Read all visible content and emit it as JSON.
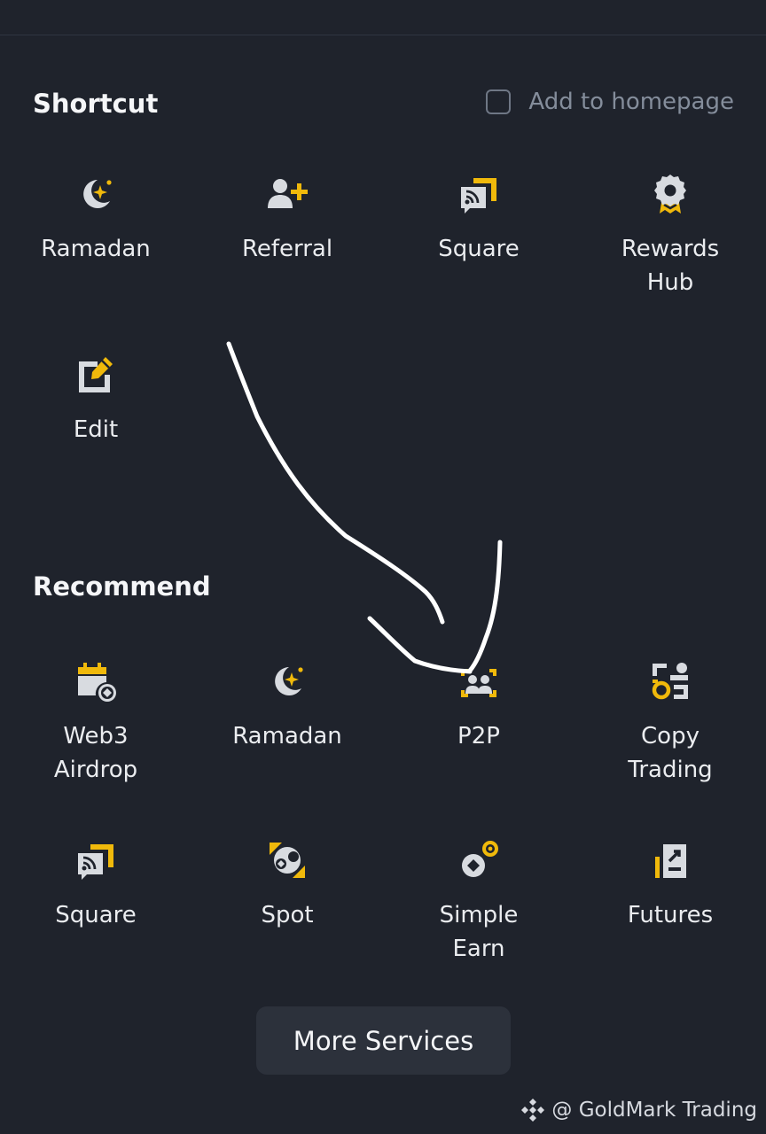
{
  "shortcut": {
    "title": "Shortcut",
    "add_to_homepage": "Add to homepage",
    "items": [
      {
        "label": "Ramadan",
        "icon": "moon-star-icon"
      },
      {
        "label": "Referral",
        "icon": "add-person-icon"
      },
      {
        "label": "Square",
        "icon": "square-feed-icon"
      },
      {
        "label": "Rewards\nHub",
        "icon": "rewards-medal-icon"
      },
      {
        "label": "Edit",
        "icon": "edit-icon"
      }
    ]
  },
  "recommend": {
    "title": "Recommend",
    "items": [
      {
        "label": "Web3\nAirdrop",
        "icon": "calendar-airdrop-icon"
      },
      {
        "label": "Ramadan",
        "icon": "moon-star-icon"
      },
      {
        "label": "P2P",
        "icon": "p2p-people-icon"
      },
      {
        "label": "Copy\nTrading",
        "icon": "copy-trading-icon"
      },
      {
        "label": "Square",
        "icon": "square-feed-icon"
      },
      {
        "label": "Spot",
        "icon": "spot-icon"
      },
      {
        "label": "Simple\nEarn",
        "icon": "simple-earn-icon"
      },
      {
        "label": "Futures",
        "icon": "futures-icon"
      }
    ]
  },
  "more_services_label": "More Services",
  "watermark": "@ GoldMark Trading",
  "colors": {
    "background": "#1f232c",
    "accent": "#f0b90b",
    "icon_gray": "#d8dbe0",
    "button_bg": "#2c313b"
  }
}
